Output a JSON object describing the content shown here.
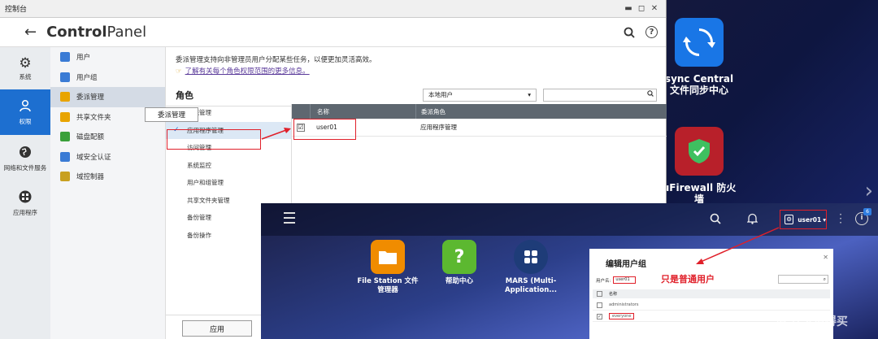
{
  "window": {
    "title": "控制台",
    "app_title_bold": "Control",
    "app_title_rest": "Panel"
  },
  "desktop": {
    "sync": {
      "label_line1": "sync Central",
      "label_line2": "文件同步中心",
      "color": "#1976e6"
    },
    "firewall": {
      "label_line1": "uFirewall 防火",
      "label_line2": "墙",
      "color": "#b8202a"
    }
  },
  "leftnav": [
    {
      "label": "系统",
      "icon": "gear-icon"
    },
    {
      "label": "权限",
      "icon": "user-icon"
    },
    {
      "label": "网络和文件服务",
      "icon": "globe-icon"
    },
    {
      "label": "应用程序",
      "icon": "apps-icon"
    }
  ],
  "subnav": [
    {
      "label": "用户",
      "color": "#3a7bd5"
    },
    {
      "label": "用户组",
      "color": "#3a7bd5"
    },
    {
      "label": "委派管理",
      "color": "#e8a400"
    },
    {
      "label": "共享文件夹",
      "color": "#e8a400"
    },
    {
      "label": "磁盘配额",
      "color": "#3aa03a"
    },
    {
      "label": "域安全认证",
      "color": "#3a7bd5"
    },
    {
      "label": "域控制器",
      "color": "#c8a020"
    }
  ],
  "tooltip": "委派管理",
  "main": {
    "description": "委派管理支持向非管理员用户分配某些任务，以便更加灵活高效。",
    "link": "了解有关每个角色权限范围的更多信息。",
    "role_label": "角色",
    "filter_value": "本地用户",
    "roles": [
      "系统管理",
      "应用程序管理",
      "访问管理",
      "系统监控",
      "用户和组管理",
      "共享文件夹管理",
      "备份管理",
      "备份操作"
    ],
    "table": {
      "headers": [
        "名称",
        "委派角色"
      ],
      "rows": [
        {
          "checked": "☑",
          "name": "user01",
          "role": "应用程序管理"
        }
      ]
    },
    "apply_label": "应用"
  },
  "qts": {
    "username": "user01",
    "notification_count": "6",
    "apps": [
      {
        "line1": "File Station 文件",
        "line2": "管理器",
        "color": "#f08c00"
      },
      {
        "line1": "帮助中心",
        "line2": "",
        "color": "#5cb830"
      },
      {
        "line1": "MARS (Multi-",
        "line2": "Application...",
        "color": "#1e3c78"
      }
    ],
    "dialog": {
      "title": "编辑用户组",
      "username_label": "用户名:",
      "username_value": "user01",
      "annotation": "只是普通用户",
      "name_header": "名称",
      "groups": [
        "administrators",
        "everyone"
      ]
    }
  },
  "watermark": "值 什么值得买"
}
